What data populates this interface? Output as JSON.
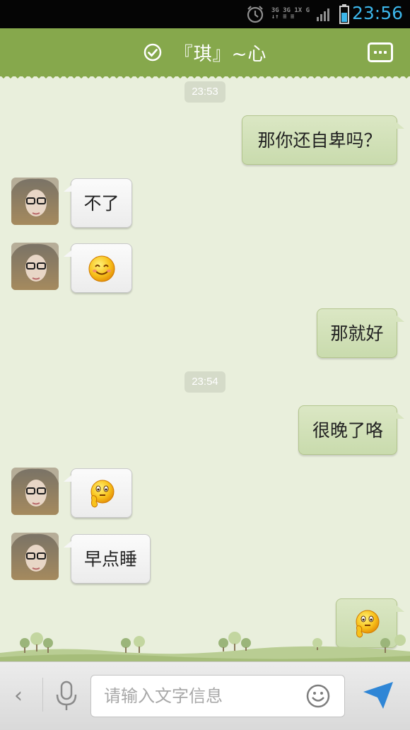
{
  "status_bar": {
    "network_top": "3G 3G 1X G",
    "time": "23:56"
  },
  "header": {
    "title": "『琪』~心",
    "status_icon": "check-circle-icon",
    "menu_icon": "more-dots-icon"
  },
  "messages": [
    {
      "type": "time",
      "text": "23:53"
    },
    {
      "type": "out",
      "text": "那你还自卑吗？"
    },
    {
      "type": "in",
      "text": "不了"
    },
    {
      "type": "in",
      "emoji": "smile-emoji-icon"
    },
    {
      "type": "out",
      "text": "那就好"
    },
    {
      "type": "time",
      "text": "23:54"
    },
    {
      "type": "out",
      "text": "很晚了咯"
    },
    {
      "type": "in",
      "emoji": "thinking-emoji-icon"
    },
    {
      "type": "in",
      "text": "早点睡"
    },
    {
      "type": "out",
      "emoji": "thinking-emoji-icon"
    }
  ],
  "input_bar": {
    "placeholder": "请输入文字信息",
    "value": ""
  },
  "colors": {
    "header": "#86a84c",
    "background": "#e9efdc",
    "bubble_out": "#d0e0b4",
    "bubble_in": "#f4f4f4",
    "status_time": "#3cb6ea",
    "send": "#2f86d6"
  }
}
